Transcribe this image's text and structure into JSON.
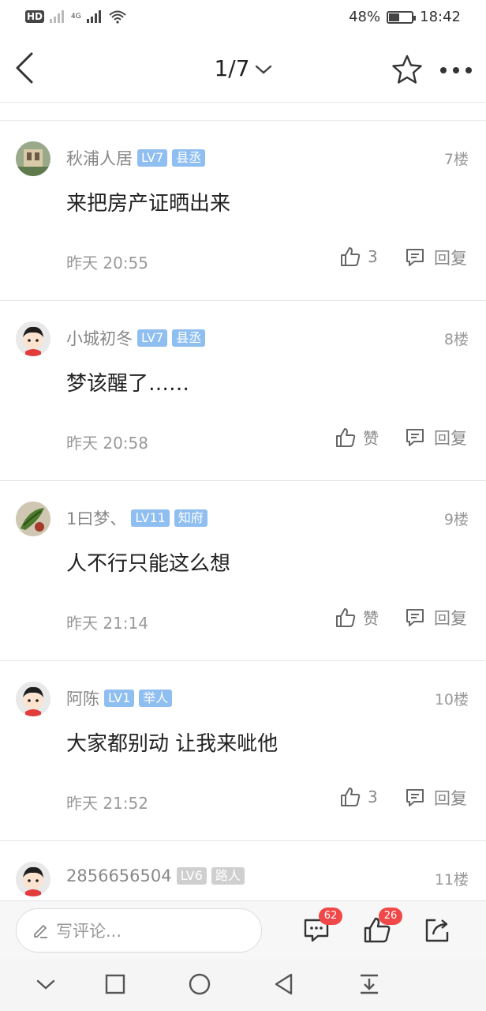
{
  "status_bar": {
    "left_indicator": "HD",
    "network": "4G",
    "battery": "48%",
    "battery_level": 0.48,
    "time": "18:42"
  },
  "nav": {
    "page_indicator": "1/7",
    "icons": [
      "back-icon",
      "chevron-down-icon",
      "star-icon",
      "more-icon"
    ]
  },
  "comments": [
    {
      "name": "秋浦人居",
      "level": "LV7",
      "title": "县丞",
      "floor": "7楼",
      "text": "来把房产证晒出来",
      "time": "昨天 20:55",
      "likes": "3",
      "reply": "回复",
      "badge_style": "blue"
    },
    {
      "name": "小城初冬",
      "level": "LV7",
      "title": "县丞",
      "floor": "8楼",
      "text": "梦该醒了……",
      "time": "昨天 20:58",
      "likes": "赞",
      "reply": "回复",
      "badge_style": "blue"
    },
    {
      "name": "1曰梦、",
      "level": "LV11",
      "title": "知府",
      "floor": "9楼",
      "text": "人不行只能这么想",
      "time": "昨天 21:14",
      "likes": "赞",
      "reply": "回复",
      "badge_style": "blue"
    },
    {
      "name": "阿陈",
      "level": "LV1",
      "title": "举人",
      "floor": "10楼",
      "text": "大家都别动 让我来呲他",
      "time": "昨天 21:52",
      "likes": "3",
      "reply": "回复",
      "badge_style": "blue"
    },
    {
      "name": "2856656504",
      "level": "LV6",
      "title": "路人",
      "floor": "11楼",
      "badge_style": "grey"
    }
  ],
  "bottom_bar": {
    "comment_placeholder": "写评论...",
    "comment_count": "62",
    "like_count": "26",
    "icons": [
      "pencil-icon",
      "comment-icon",
      "like-icon",
      "share-icon"
    ]
  },
  "system_nav": {
    "icons": [
      "collapse-icon",
      "recent-apps-icon",
      "home-icon",
      "back-nav-icon",
      "notification-pull-icon"
    ]
  },
  "colors": {
    "badge_blue": "#8fbef0",
    "badge_grey": "#cfcfcf",
    "count_red": "#f04848",
    "text_grey": "#888888"
  }
}
